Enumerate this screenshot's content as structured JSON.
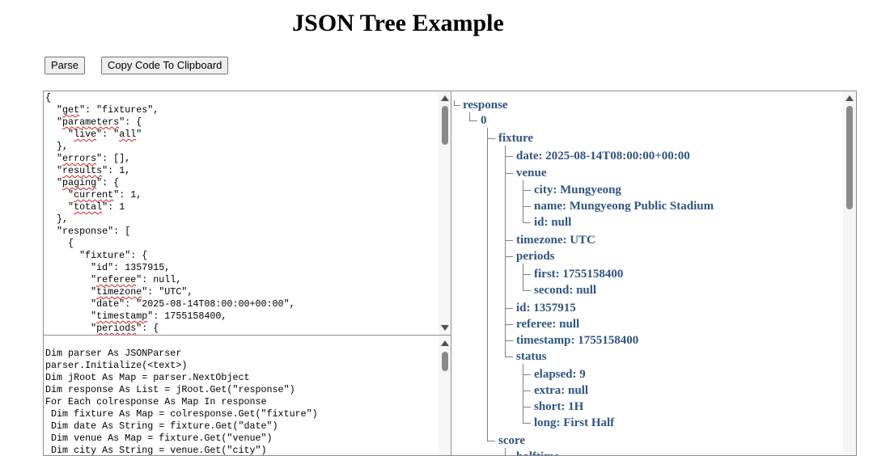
{
  "page": {
    "title": "JSON Tree Example"
  },
  "toolbar": {
    "parse_label": "Parse",
    "copy_label": "Copy Code To Clipboard"
  },
  "json_lines": [
    "{",
    "  \"get\": \"fixtures\",",
    "  \"parameters\": {",
    "    \"live\": \"all\"",
    "  },",
    "  \"errors\": [],",
    "  \"results\": 1,",
    "  \"paging\": {",
    "    \"current\": 1,",
    "    \"total\": 1",
    "  },",
    "  \"response\": [",
    "    {",
    "      \"fixture\": {",
    "        \"id\": 1357915,",
    "        \"referee\": null,",
    "        \"timezone\": \"UTC\",",
    "        \"date\": \"2025-08-14T08:00:00+00:00\",",
    "        \"timestamp\": 1755158400,",
    "        \"periods\": {"
  ],
  "code_lines": [
    "Dim parser As JSONParser",
    "parser.Initialize(<text>)",
    "Dim jRoot As Map = parser.NextObject",
    "Dim response As List = jRoot.Get(\"response\")",
    "For Each colresponse As Map In response",
    " Dim fixture As Map = colresponse.Get(\"fixture\")",
    " Dim date As String = fixture.Get(\"date\")",
    " Dim venue As Map = fixture.Get(\"venue\")",
    " Dim city As String = venue.Get(\"city\")"
  ],
  "tree": [
    {
      "label": "response",
      "depth": 0
    },
    {
      "label": "0",
      "depth": 1
    },
    {
      "label": "fixture",
      "depth": 2
    },
    {
      "label": "date: 2025-08-14T08:00:00+00:00",
      "depth": 3
    },
    {
      "label": "venue",
      "depth": 3
    },
    {
      "label": "city: Mungyeong",
      "depth": 4
    },
    {
      "label": "name: Mungyeong Public Stadium",
      "depth": 4
    },
    {
      "label": "id: null",
      "depth": 4
    },
    {
      "label": "timezone: UTC",
      "depth": 3
    },
    {
      "label": "periods",
      "depth": 3
    },
    {
      "label": "first: 1755158400",
      "depth": 4
    },
    {
      "label": "second: null",
      "depth": 4
    },
    {
      "label": "id: 1357915",
      "depth": 3
    },
    {
      "label": "referee: null",
      "depth": 3
    },
    {
      "label": "timestamp: 1755158400",
      "depth": 3
    },
    {
      "label": "status",
      "depth": 3
    },
    {
      "label": "elapsed: 9",
      "depth": 4
    },
    {
      "label": "extra: null",
      "depth": 4
    },
    {
      "label": "short: 1H",
      "depth": 4
    },
    {
      "label": "long: First Half",
      "depth": 4
    },
    {
      "label": "score",
      "depth": 2
    },
    {
      "label": "halftime",
      "depth": 3
    }
  ]
}
